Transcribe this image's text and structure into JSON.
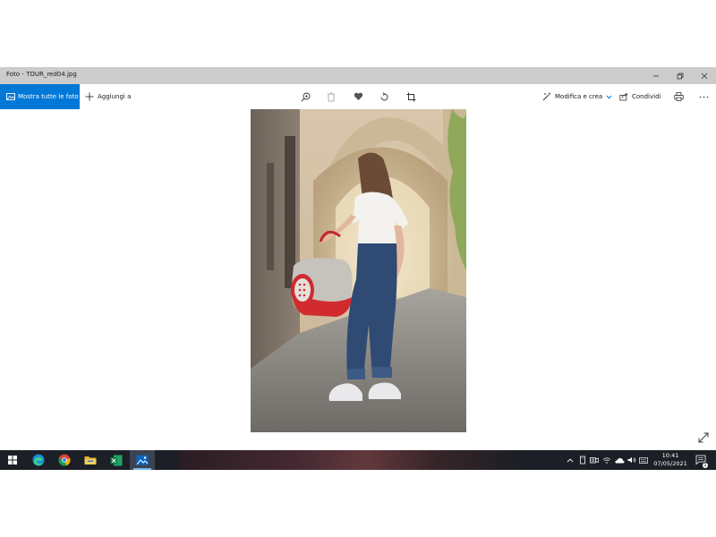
{
  "window": {
    "title": "Foto - TOUR_red04.jpg"
  },
  "toolbar": {
    "show_all_label": "Mostra tutte le foto",
    "add_to_label": "Aggiungi a",
    "edit_create_label": "Modifica e crea",
    "share_label": "Condividi",
    "icons": [
      "zoom-icon",
      "delete-icon",
      "heart-icon",
      "rotate-icon",
      "crop-icon",
      "print-icon",
      "more-icon"
    ]
  },
  "taskbar": {
    "apps": [
      "start",
      "edge",
      "chrome",
      "file-explorer",
      "excel",
      "photos"
    ],
    "active_app": "photos",
    "time": "10:41",
    "date": "07/05/2021",
    "notification_count": "1"
  },
  "colors": {
    "accent": "#0078d7",
    "titlebar": "#cccccc",
    "taskbar": "#1c1f26"
  }
}
